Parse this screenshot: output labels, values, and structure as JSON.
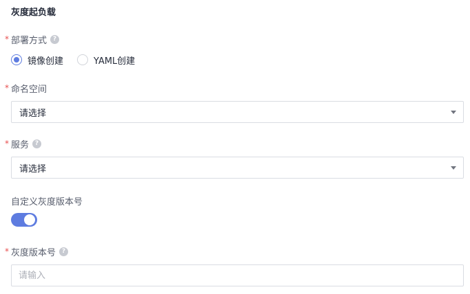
{
  "section": {
    "title": "灰度起负载"
  },
  "deploy_method": {
    "required_mark": "*",
    "label": "部署方式",
    "help": "?",
    "options": [
      {
        "label": "镜像创建",
        "selected": true
      },
      {
        "label": "YAML创建",
        "selected": false
      }
    ]
  },
  "namespace": {
    "required_mark": "*",
    "label": "命名空间",
    "value": "请选择"
  },
  "service": {
    "required_mark": "*",
    "label": "服务",
    "help": "?",
    "value": "请选择"
  },
  "custom_version": {
    "label": "自定义灰度版本号",
    "enabled": true
  },
  "gray_version": {
    "required_mark": "*",
    "label": "灰度版本号",
    "help": "?",
    "placeholder": "请输入",
    "value": ""
  },
  "colors": {
    "accent": "#5e7ce0",
    "required": "#e84e4e"
  }
}
